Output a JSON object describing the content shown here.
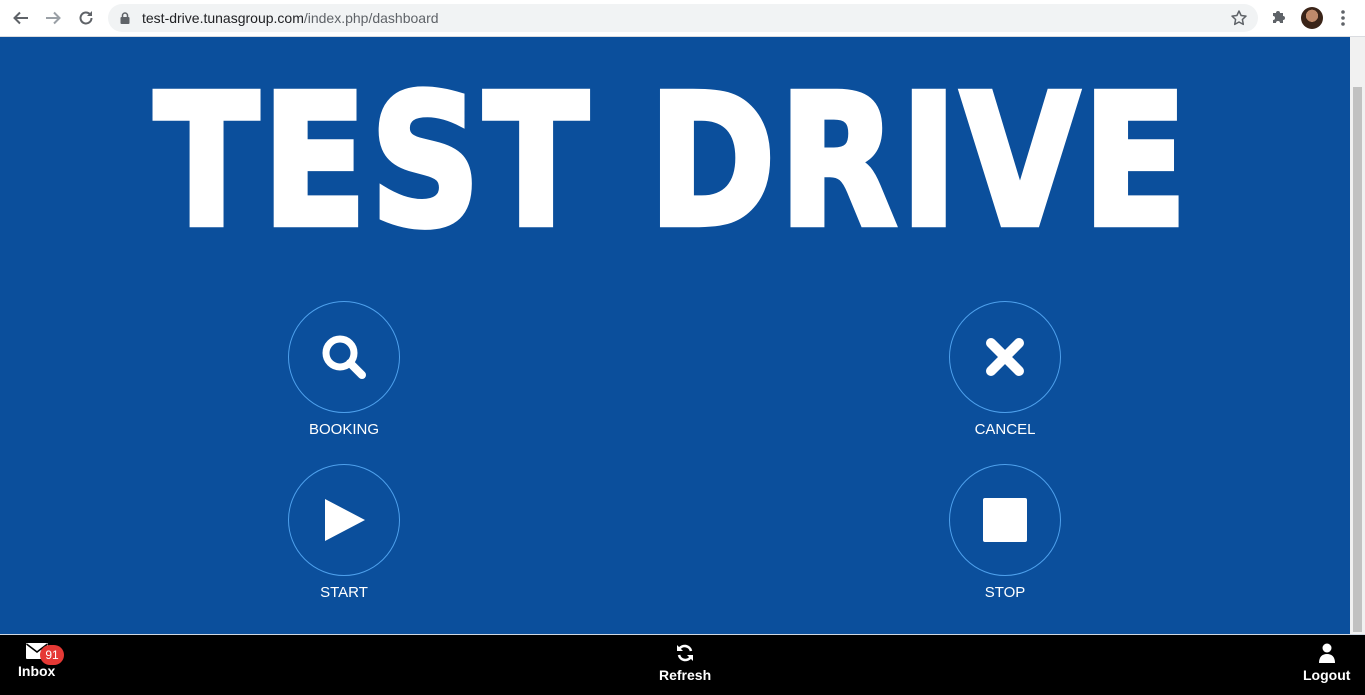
{
  "browser": {
    "url_host": "test-drive.tunasgroup.com",
    "url_path": "/index.php/dashboard",
    "back_icon": "arrow-left",
    "forward_icon": "arrow-right",
    "reload_icon": "reload",
    "bookmark_icon": "star-outline",
    "extensions_icon": "puzzle-piece",
    "menu_icon": "three-dots-vertical"
  },
  "hero": {
    "title": "TEST DRIVE"
  },
  "actions": {
    "booking": {
      "label": "BOOKING",
      "icon": "search"
    },
    "cancel": {
      "label": "CANCEL",
      "icon": "x"
    },
    "start": {
      "label": "START",
      "icon": "play"
    },
    "stop": {
      "label": "STOP",
      "icon": "stop"
    }
  },
  "bottom_nav": {
    "inbox": {
      "label": "Inbox",
      "badge": "91",
      "icon": "envelope"
    },
    "refresh": {
      "label": "Refresh",
      "icon": "refresh"
    },
    "logout": {
      "label": "Logout",
      "icon": "user"
    }
  },
  "colors": {
    "page_background": "#0b4f9c",
    "circle_border": "#4ea0ec",
    "badge": "#e53935",
    "bottom_bar": "#000000"
  }
}
